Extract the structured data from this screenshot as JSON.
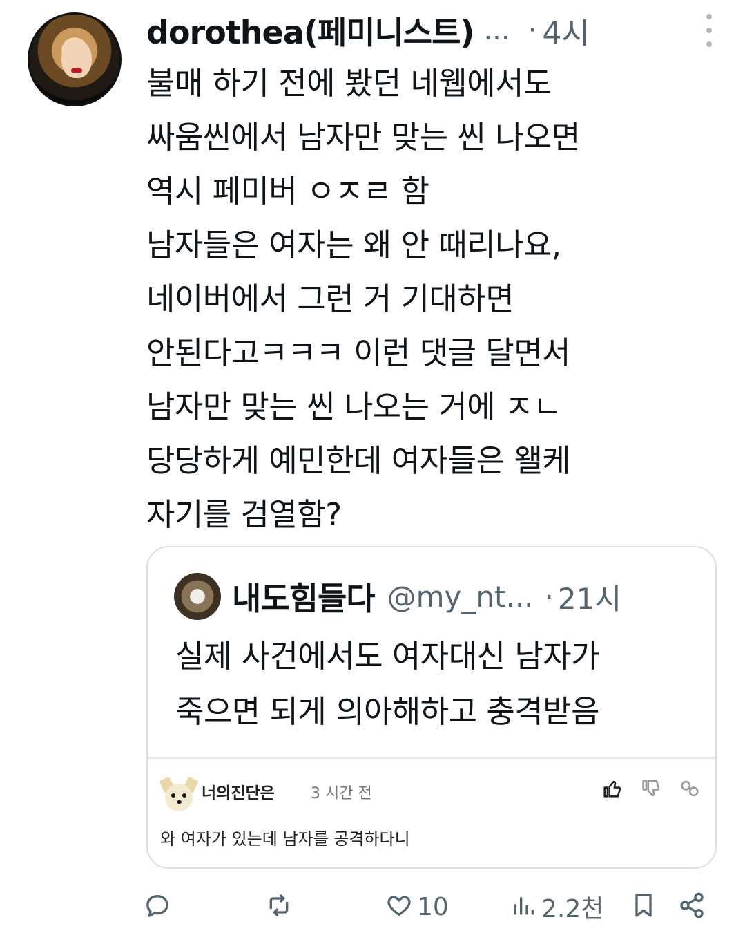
{
  "post": {
    "display_name": "dorothea(페미니스트)",
    "handle_truncated": "...",
    "separator": "·",
    "time": "4시",
    "lines": [
      "불매 하기 전에 봤던 네웹에서도",
      "싸움씬에서 남자만 맞는 씬 나오면",
      "역시 페미버 ㅇㅈㄹ 함",
      "남자들은 여자는 왜 안 때리나요,",
      "네이버에서 그런 거 기대하면",
      "안된다고ㅋㅋㅋ 이런 댓글 달면서",
      "남자만 맞는 씬 나오는 거에 ㅈㄴ",
      "당당하게 예민한데 여자들은 왤케",
      "자기를 검열함?"
    ]
  },
  "quote": {
    "display_name": "내도힘들다",
    "handle": "@my_nt...",
    "separator": "·",
    "time": "21시",
    "lines": [
      "실제 사건에서도 여자대신 남자가",
      "죽으면 되게 의아해하고 충격받음"
    ],
    "comment": {
      "username": "너의진단은",
      "time": "3 시간 전",
      "text": "와 여자가 있는데 남자를 공격하다니"
    }
  },
  "actions": {
    "reply_count": "",
    "retweet_count": "",
    "like_count": "10",
    "views_count": "2.2천"
  },
  "colors": {
    "text": "#0f1419",
    "secondary": "#536471",
    "border": "#d9e0e5"
  }
}
